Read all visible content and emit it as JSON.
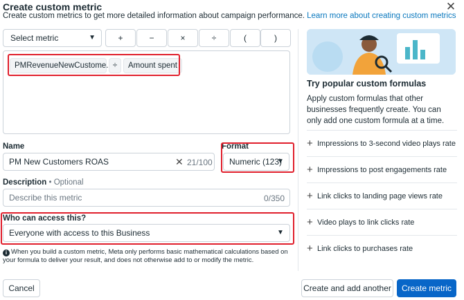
{
  "dialog": {
    "title": "Create custom metric",
    "subtitle": "Create custom metrics to get more detailed information about campaign performance.",
    "learn_more": "Learn more about creating custom metrics"
  },
  "toolbar": {
    "select_metric": "Select metric",
    "operators": [
      "+",
      "−",
      "×",
      "÷",
      "(",
      ")"
    ]
  },
  "formula": {
    "chips": [
      "PMRevenueNewCustome...",
      "÷",
      "Amount spent"
    ]
  },
  "name": {
    "label": "Name",
    "value": "PM New Customers ROAS",
    "count": "21/100"
  },
  "format": {
    "label": "Format",
    "value": "Numeric (123)"
  },
  "description": {
    "label": "Description",
    "optional": "• Optional",
    "placeholder": "Describe this metric",
    "count": "0/350"
  },
  "access": {
    "label": "Who can access this?",
    "value": "Everyone with access to this Business"
  },
  "info_text": "When you build a custom metric, Meta only performs basic mathematical calculations based on your formula to deliver your result, and does not otherwise add to or modify the metric.",
  "side": {
    "title": "Try popular custom formulas",
    "description": "Apply custom formulas that other businesses frequently create. You can only add one custom formula at a time.",
    "suggestions": [
      "Impressions to 3-second video plays rate",
      "Impressions to post engagements rate",
      "Link clicks to landing page views rate",
      "Video plays to link clicks rate",
      "Link clicks to purchases rate"
    ]
  },
  "footer": {
    "cancel": "Cancel",
    "create_add": "Create and add another",
    "create": "Create metric"
  },
  "colors": {
    "accent": "#0a78be",
    "highlight": "#e01e2b",
    "primary_button": "#0866c8"
  }
}
